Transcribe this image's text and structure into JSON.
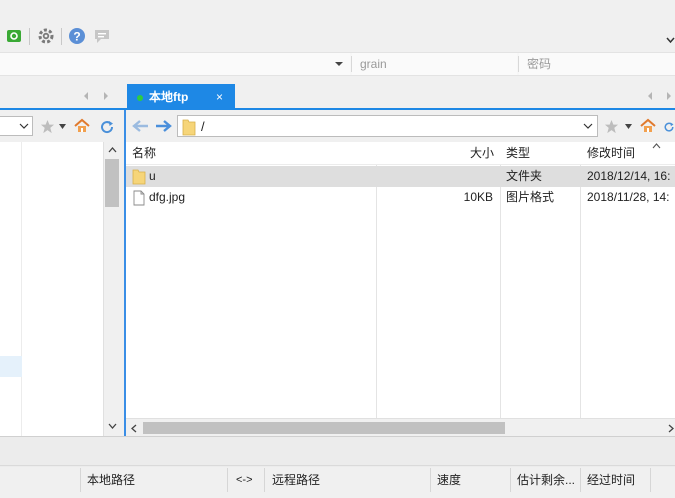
{
  "toolbar": {
    "icons": [
      "app-green-icon",
      "gear-icon",
      "help-icon",
      "message-icon",
      "collapse-caret-icon"
    ]
  },
  "address_bar": {
    "username_placeholder": "grain",
    "password_placeholder": "密码"
  },
  "tabs": [
    {
      "label": "本地ftp",
      "status_color": "#2ecc40",
      "close": "×"
    }
  ],
  "right_pane": {
    "path": "/",
    "columns": {
      "name": "名称",
      "size": "大小",
      "type": "类型",
      "modified": "修改时间"
    },
    "rows": [
      {
        "name": "u",
        "size": "",
        "type": "文件夹",
        "modified": "2018/12/14, 16:",
        "kind": "folder",
        "selected": true
      },
      {
        "name": "dfg.jpg",
        "size": "10KB",
        "type": "图片格式",
        "modified": "2018/11/28, 14:",
        "kind": "file",
        "selected": false
      }
    ]
  },
  "queue": {
    "headers": {
      "local_path": "本地路径",
      "direction": "<->",
      "remote_path": "远程路径",
      "speed": "速度",
      "eta": "估计剩余...",
      "elapsed": "经过时间"
    }
  },
  "colors": {
    "accent": "#1e88e5",
    "selected_row": "#dedede",
    "folder": "#f6d579"
  }
}
